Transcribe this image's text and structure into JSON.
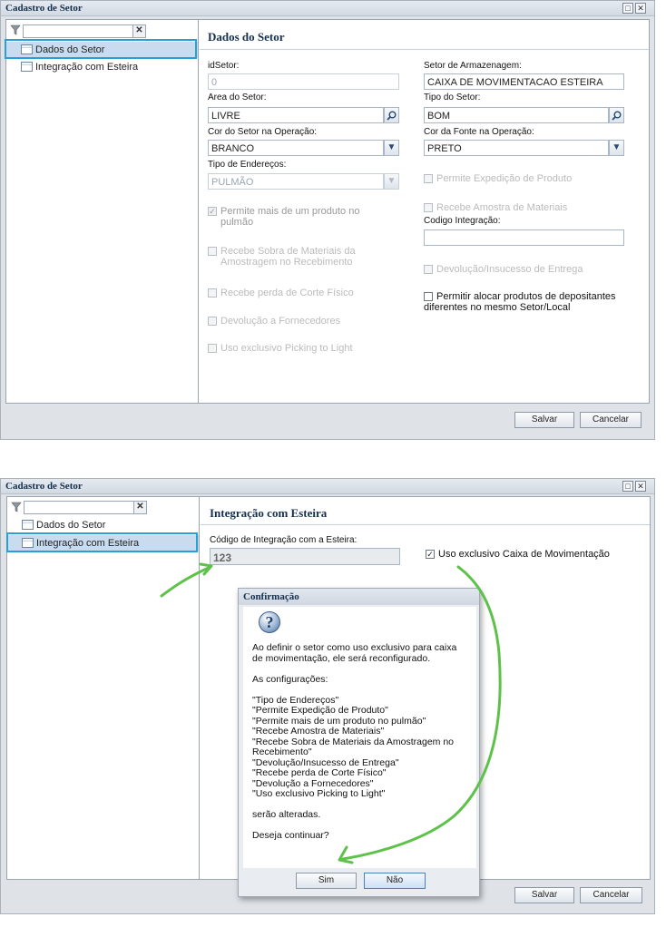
{
  "window1": {
    "title": "Cadastro de Setor",
    "tree": [
      {
        "label": "Dados do Setor",
        "selected": true
      },
      {
        "label": "Integração com Esteira",
        "selected": false
      }
    ],
    "panel_title": "Dados do Setor",
    "fields": {
      "idsetor_label": "idSetor:",
      "idsetor_value": "0",
      "area_label": "Area do Setor:",
      "area_value": "LIVRE",
      "cor_setor_label": "Cor do Setor na Operação:",
      "cor_setor_value": "BRANCO",
      "tipo_end_label": "Tipo de Endereços:",
      "tipo_end_value": "PULMÃO",
      "setor_arm_label": "Setor de Armazenagem:",
      "setor_arm_value": "CAIXA DE MOVIMENTACAO ESTEIRA",
      "tipo_setor_label": "Tipo do Setor:",
      "tipo_setor_value": "BOM",
      "cor_fonte_label": "Cor da Fonte na Operação:",
      "cor_fonte_value": "PRETO",
      "cod_integ_label": "Codigo Integração:",
      "cod_integ_value": ""
    },
    "checks_left": [
      {
        "label": "Permite mais de um produto no pulmão",
        "checked": true
      },
      {
        "label": "Recebe Sobra de Materiais da Amostragem no Recebimento",
        "checked": false
      },
      {
        "label": "Recebe perda de Corte Físico",
        "checked": false
      },
      {
        "label": "Devolução a Fornecedores",
        "checked": false
      },
      {
        "label": "Uso exclusivo Picking to Light",
        "checked": false
      }
    ],
    "checks_right": [
      {
        "label": "Permite Expedição de Produto",
        "checked": false
      },
      {
        "label": "Recebe Amostra de Materiais",
        "checked": false
      },
      {
        "label": "Devolução/Insucesso de Entrega",
        "checked": false
      },
      {
        "label": "Permitir alocar produtos de depositantes diferentes no mesmo Setor/Local",
        "checked": false
      }
    ],
    "save_label": "Salvar",
    "cancel_label": "Cancelar"
  },
  "window2": {
    "title": "Cadastro de Setor",
    "tree": [
      {
        "label": "Dados do Setor",
        "selected": false
      },
      {
        "label": "Integração com Esteira",
        "selected": true
      }
    ],
    "panel_title": "Integração com Esteira",
    "cod_label": "Código de Integração com a Esteira:",
    "cod_value": "123",
    "uso_label": "Uso exclusivo Caixa de Movimentação",
    "uso_checked": true,
    "save_label": "Salvar",
    "cancel_label": "Cancelar"
  },
  "dialog": {
    "title": "Confirmação",
    "message": "Ao definir o setor como uso exclusivo para caixa\nde movimentação, ele será reconfigurado.\n\nAs configurações:\n\n\"Tipo de Endereços\"\n\"Permite Expedição de Produto\"\n\"Permite mais de um produto no pulmão\"\n\"Recebe Amostra de Materiais\"\n\"Recebe Sobra de Materiais da Amostragem no\nRecebimento\"\n\"Devolução/Insucesso de Entrega\"\n\"Recebe perda de Corte Físico\"\n\"Devolução a Fornecedores\"\n\"Uso exclusivo Picking to Light\"\n\nserão alteradas.\n\nDeseja continuar?",
    "yes_label": "Sim",
    "no_label": "Não"
  },
  "colors": {
    "highlight": "#2a9fd6",
    "arrow": "#5ec24a",
    "title_text": "#15304f"
  }
}
